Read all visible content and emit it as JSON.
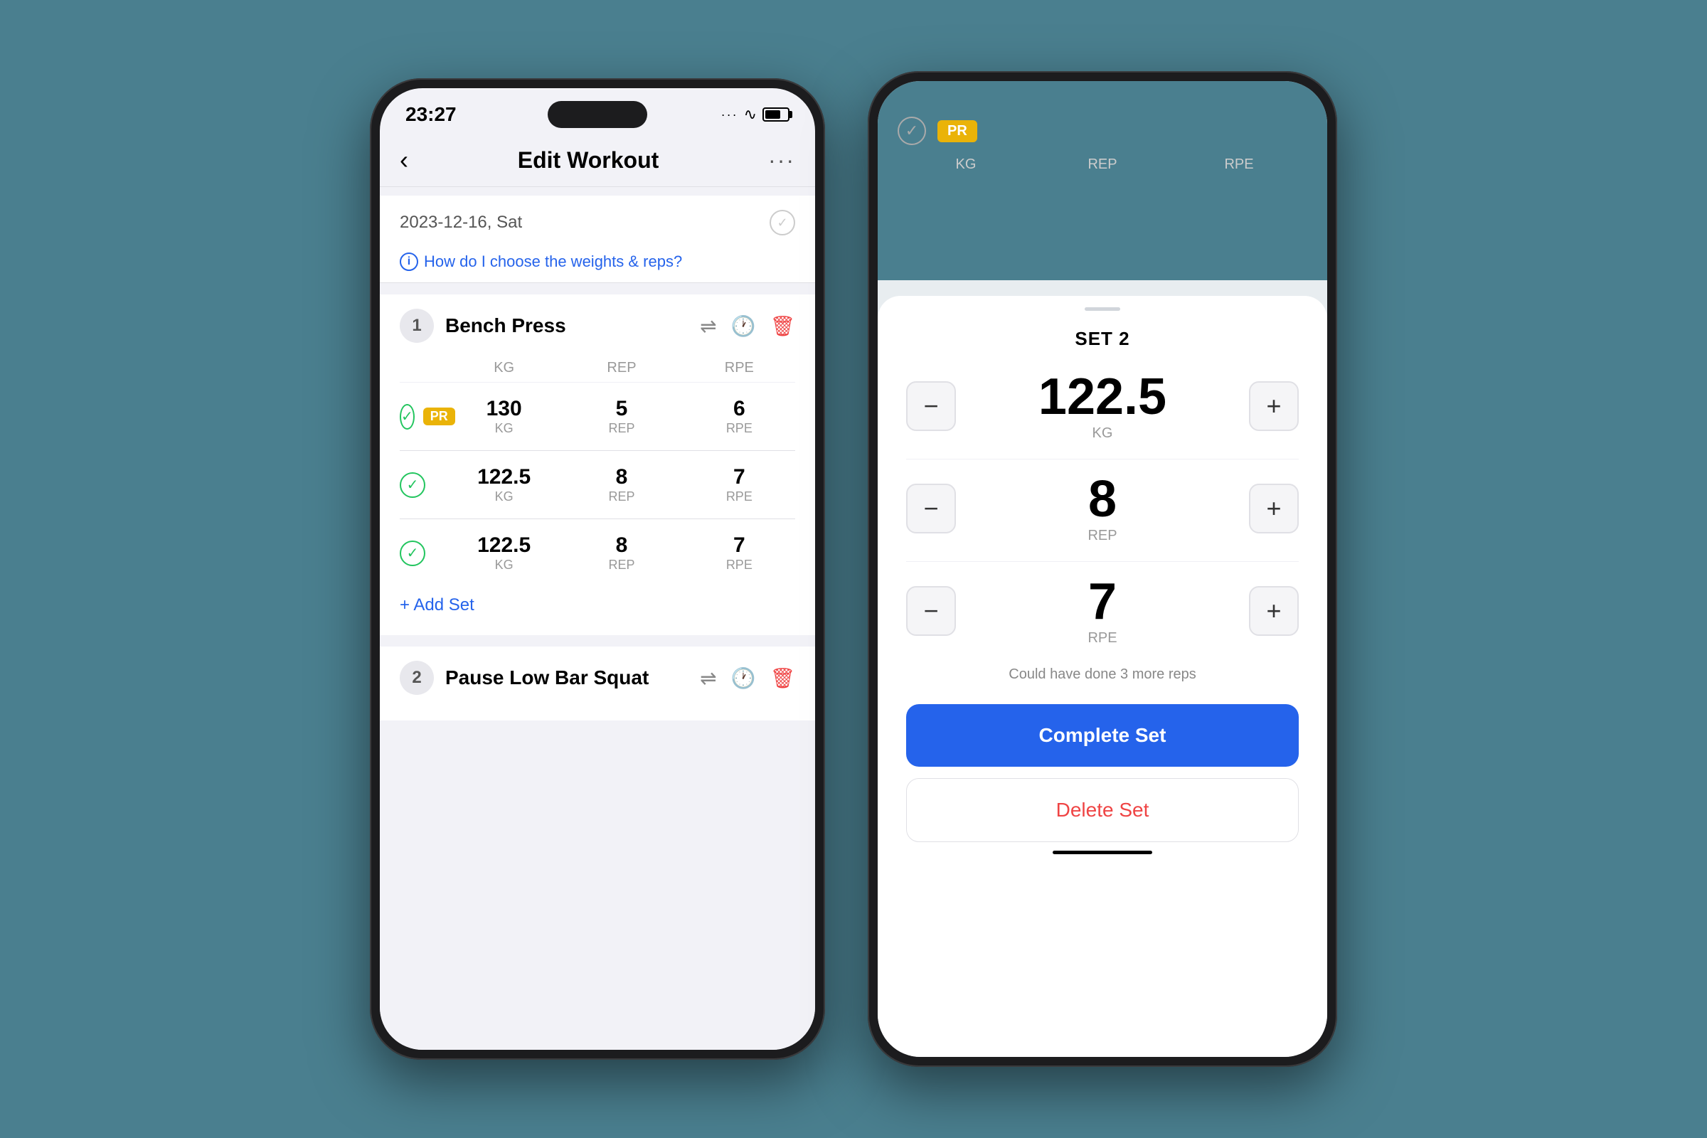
{
  "app": {
    "background_color": "#4a7f8f"
  },
  "phone1": {
    "status_bar": {
      "time": "23:27",
      "wifi": "⊙",
      "battery_label": "battery"
    },
    "nav": {
      "back_label": "‹",
      "title": "Edit Workout",
      "more_label": "···"
    },
    "date_row": {
      "date": "2023-12-16, Sat"
    },
    "info_link": "How do I choose the weights & reps?",
    "exercise1": {
      "number": "1",
      "name": "Bench Press",
      "col_kg": "KG",
      "col_rep": "REP",
      "col_rpe": "RPE",
      "sets": [
        {
          "has_pr": true,
          "pr_label": "PR",
          "kg": "130",
          "kg_unit": "KG",
          "rep": "5",
          "rep_unit": "REP",
          "rpe": "6",
          "rpe_unit": "RPE"
        },
        {
          "has_pr": false,
          "kg": "122.5",
          "kg_unit": "KG",
          "rep": "8",
          "rep_unit": "REP",
          "rpe": "7",
          "rpe_unit": "RPE"
        },
        {
          "has_pr": false,
          "kg": "122.5",
          "kg_unit": "KG",
          "rep": "8",
          "rep_unit": "REP",
          "rpe": "7",
          "rpe_unit": "RPE"
        }
      ],
      "add_set_label": "+ Add Set"
    },
    "exercise2": {
      "number": "2",
      "name": "Pause Low Bar Squat"
    }
  },
  "phone2": {
    "bg_col_headers": [
      "KG",
      "REP",
      "RPE"
    ],
    "sheet": {
      "set_label": "SET 2",
      "handle_label": "handle",
      "kg_value": "122.5",
      "kg_unit": "KG",
      "rep_value": "8",
      "rep_unit": "REP",
      "rpe_value": "7",
      "rpe_unit": "RPE",
      "rpe_hint": "Could have done 3 more reps",
      "complete_label": "Complete Set",
      "delete_label": "Delete Set"
    }
  }
}
